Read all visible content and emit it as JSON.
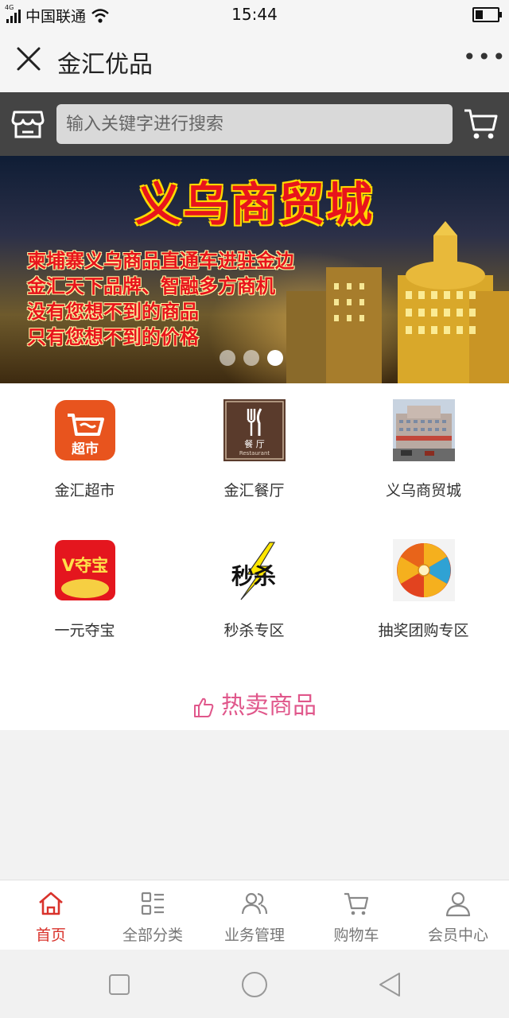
{
  "status_bar": {
    "network_type": "4G",
    "carrier": "中国联通",
    "time": "15:44",
    "battery_level": 0.35
  },
  "header": {
    "close_icon": "close-icon",
    "title": "金汇优品",
    "more_label": "•••"
  },
  "search": {
    "placeholder": "输入关键字进行搜索",
    "value": ""
  },
  "banner": {
    "title": "义乌商贸城",
    "lines": [
      "柬埔寨义乌商品直通车进驻金边",
      "金汇天下品牌、智融多方商机",
      "没有您想不到的商品",
      "只有您想不到的价格"
    ],
    "slides_count": 3,
    "active_slide": 3
  },
  "categories": [
    {
      "label": "金汇超市",
      "icon": "supermarket-icon",
      "icon_text": "超市"
    },
    {
      "label": "金汇餐厅",
      "icon": "restaurant-icon",
      "icon_text": "餐 厅",
      "icon_subtext": "Restaurant"
    },
    {
      "label": "义乌商贸城",
      "icon": "trade-city-photo"
    },
    {
      "label": "一元夺宝",
      "icon": "treasure-icon",
      "icon_text": "V夺宝"
    },
    {
      "label": "秒杀专区",
      "icon": "flash-sale-icon",
      "icon_text": "秒杀"
    },
    {
      "label": "抽奖团购专区",
      "icon": "lottery-wheel-icon"
    }
  ],
  "hot_section": {
    "title": "热卖商品",
    "icon": "thumbs-up-icon"
  },
  "bottom_nav": [
    {
      "label": "首页",
      "icon": "home-icon",
      "active": true
    },
    {
      "label": "全部分类",
      "icon": "category-icon",
      "active": false
    },
    {
      "label": "业务管理",
      "icon": "users-icon",
      "active": false
    },
    {
      "label": "购物车",
      "icon": "cart-icon",
      "active": false
    },
    {
      "label": "会员中心",
      "icon": "user-icon",
      "active": false
    }
  ],
  "colors": {
    "accent": "#d9322b",
    "hot_pink": "#e0578b",
    "search_bar_bg": "#444444"
  }
}
